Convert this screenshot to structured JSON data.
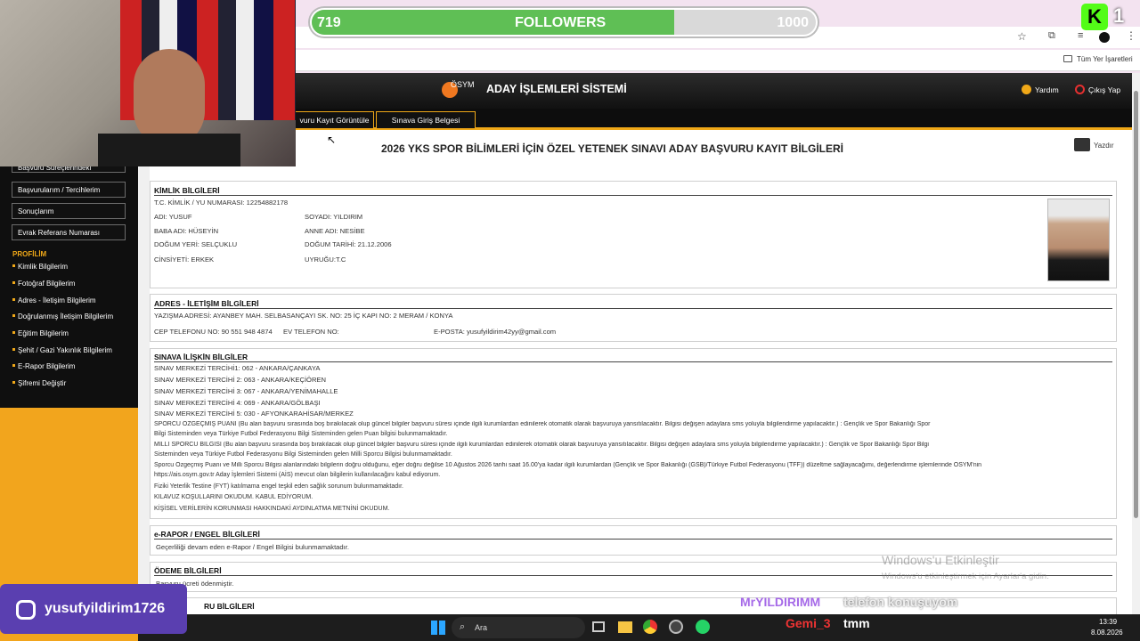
{
  "overlay": {
    "followers_current": "719",
    "followers_label": "FOLLOWERS",
    "followers_goal": "1000",
    "followers_progress": 0.719,
    "instagram_handle": "yusufyildirim1726",
    "kick_badge": "K",
    "kick_count": "1",
    "chat_user": "MrYILDIRIMM",
    "chat_message": "telefon konuşuyom",
    "bot_user": "Gemi_3",
    "bot_message": "tmm"
  },
  "browser": {
    "bookmarks_label": "Tüm Yer İşaretleri"
  },
  "header": {
    "logo_text": "ÖSYM",
    "system_title": "ADAY İŞLEMLERİ SİSTEMİ",
    "help_label": "Yardım",
    "logout_label": "Çıkış Yap"
  },
  "nav": {
    "tab1": "vuru Kayıt Görüntüle",
    "tab2": "Sınava Giriş Belgesi"
  },
  "sidebar": {
    "top_cut": "Başvuru Süreçlerindeki",
    "buttons": [
      "Başvurularım / Tercihlerim",
      "Sonuçlarım",
      "Evrak Referans Numarası"
    ],
    "profile_heading": "PROFİLİM",
    "links": [
      "Kimlik Bilgilerim",
      "Fotoğraf Bilgilerim",
      "Adres - İletişim Bilgilerim",
      "Doğrulanmış İletişim Bilgilerim",
      "Eğitim Bilgilerim",
      "Şehit / Gazi Yakınlık Bilgilerim",
      "E-Rapor Bilgilerim",
      "Şifremi Değiştir"
    ]
  },
  "page": {
    "title": "2026 YKS SPOR BİLİMLERİ İÇİN ÖZEL YETENEK SINAVI ADAY BAŞVURU KAYIT BİLGİLERİ",
    "print_label": "Yazdır"
  },
  "identity": {
    "title": "KİMLİK BİLGİLERİ",
    "tc": "T.C. KİMLİK / YU NUMARASI: 12254882178",
    "name": "ADI: YUSUF",
    "surname": "SOYADI: YILDIRIM",
    "father": "BABA ADI: HÜSEYİN",
    "mother": "ANNE ADI: NESİBE",
    "birthplace": "DOĞUM YERİ: SELÇUKLU",
    "birthdate": "DOĞUM TARİHİ: 21.12.2006",
    "gender": "CİNSİYETİ: ERKEK",
    "nationality": "UYRUĞU:T.C"
  },
  "address": {
    "title": "ADRES - İLETİŞİM BİLGİLERİ",
    "address_line": "YAZIŞMA ADRESİ: AYANBEY MAH. SELBASANÇAYI SK. NO: 25 İÇ KAPI NO: 2 MERAM / KONYA",
    "mobile": "CEP TELEFONU NO: 90 551 948 4874",
    "home_phone": "EV TELEFON NO:",
    "email": "E-POSTA: yusufyildirim42yy@gmail.com"
  },
  "exam": {
    "title": "SINAVA İLİŞKİN BİLGİLER",
    "prefs": [
      "SINAV MERKEZİ TERCİHİ1: 062 - ANKARA/ÇANKAYA",
      "SINAV MERKEZİ TERCİHİ 2: 063 - ANKARA/KEÇİÖREN",
      "SINAV MERKEZİ TERCİHİ 3: 067 - ANKARA/YENİMAHALLE",
      "SINAV MERKEZİ TERCİHİ 4: 069 - ANKARA/GÖLBAŞI",
      "SINAV MERKEZİ TERCİHİ 5: 030 - AFYONKARAHİSAR/MERKEZ"
    ],
    "bio_score_1": "SPORCU ÖZGEÇMİŞ PUANI (Bu alan başvuru sırasında boş bırakılacak olup güncel bilgiler başvuru süresi içinde ilgili kurumlardan edinilerek otomatik olarak başvuruya yansıtılacaktır. Bilgisi değişen adaylara sms yoluyla bilgilendirme yapılacaktır.) : Gençlik ve Spor Bakanlığı Spor",
    "bio_score_2": "Bilgi Sisteminden veya Türkiye Futbol Federasyonu Bilgi Sisteminden gelen Puan bilgisi bulunmamaktadır.",
    "national_1": "MİLLİ SPORCU BİLGİSİ (Bu alan başvuru sırasında boş bırakılacak olup güncel bilgiler başvuru süresi içinde ilgili kurumlardan edinilerek otomatik olarak başvuruya yansıtılacaktır. Bilgisi değişen adaylara sms yoluyla bilgilendirme yapılacaktır.) : Gençlik ve Spor Bakanlığı Spor Bilgi",
    "national_2": "Sisteminden veya Türkiye Futbol Federasyonu Bilgi Sisteminden gelen Milli Sporcu Bilgisi bulunmamaktadır.",
    "note_1": "Sporcu Özgeçmiş Puanı ve Milli Sporcu Bilgisi alanlarındaki bilgilerin doğru olduğunu, eğer doğru değilse 10 Ağustos 2026 tarihi saat 16.00'ya kadar ilgili kurumlardan (Gençlik ve Spor Bakanlığı (GSB)/Türkiye Futbol Federasyonu (TFF)) düzeltme sağlayacağımı, değerlendirme işlemlerinde ÖSYM'nin",
    "note_2": "https://ais.osym.gov.tr Aday İşlemleri Sistemi (AİS) mevcut olan bilgilerin kullanılacağını kabul ediyorum.",
    "note_3": "Fiziki Yeterlik Testine (FYT) katılmama engel teşkil eden sağlık sorunum bulunmamaktadır.",
    "guide": "KILAVUZ KOŞULLARINI OKUDUM. KABUL EDİYORUM.",
    "kvkk": "KİŞİSEL VERİLERİN KORUNMASI HAKKINDAKİ AYDINLATMA METNİNİ OKUDUM."
  },
  "erapor": {
    "title": "e-RAPOR / ENGEL BİLGİLERİ",
    "text": "Geçerliliği devam eden e-Rapor / Engel Bilgisi bulunmamaktadır."
  },
  "payment": {
    "title": "ÖDEME BİLGİLERİ",
    "text": "Başvuru ücreti ödenmiştir."
  },
  "last_section": {
    "title": "RU BİLGİLERİ"
  },
  "windows": {
    "activate_title": "Windows'u Etkinleştir",
    "activate_sub": "Windows'u etkinleştirmek için Ayarlar'a gidin.",
    "search": "Ara",
    "time": "13:39",
    "date": "8.08.2026"
  }
}
